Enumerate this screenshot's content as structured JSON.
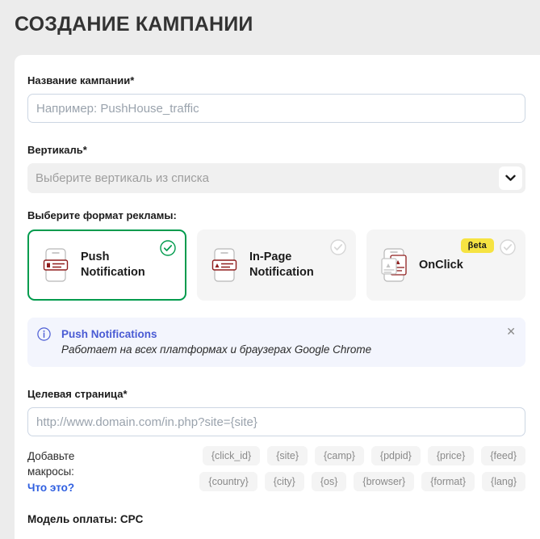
{
  "page": {
    "title": "СОЗДАНИЕ КАМПАНИИ"
  },
  "form": {
    "campaign_name": {
      "label": "Название кампании*",
      "placeholder": "Например: PushHouse_traffic",
      "value": ""
    },
    "vertical": {
      "label": "Вертикаль*",
      "placeholder": "Выберите вертикаль из списка",
      "chevron_icon": "chevron-down-icon"
    },
    "format_section_label": "Выберите формат рекламы:",
    "formats": [
      {
        "label": "Push Notification",
        "icon": "push-notification-phone-icon",
        "selected": true,
        "check_icon": "check-circle-icon",
        "badge": null
      },
      {
        "label": "In-Page Notification",
        "icon": "in-page-notification-phone-icon",
        "selected": false,
        "check_icon": "check-circle-icon",
        "badge": null
      },
      {
        "label": "OnClick",
        "icon": "onclick-phone-icon",
        "selected": false,
        "check_icon": "check-circle-icon",
        "badge": "βeta"
      }
    ],
    "info_banner": {
      "icon": "info-circle-icon",
      "title": "Push Notifications",
      "text": "Работает на всех платформах и браузерах Google Chrome",
      "close_label": "✕"
    },
    "landing_page": {
      "label": "Целевая страница*",
      "placeholder": "http://www.domain.com/in.php?site={site}",
      "value": ""
    },
    "macros": {
      "prompt_line1": "Добавьте",
      "prompt_line2": "макросы:",
      "link": "Что это?",
      "row1": [
        "{click_id}",
        "{site}",
        "{camp}",
        "{pdpid}",
        "{price}",
        "{feed}",
        "{country}",
        "{city}"
      ],
      "row2": [
        "{os}",
        "{browser}",
        "{format}",
        "{lang}"
      ]
    },
    "payment_model": "Модель оплаты: CPC"
  },
  "colors": {
    "page_bg": "#ececec",
    "card_bg": "#ffffff",
    "accent_green": "#009b4d",
    "accent_blue": "#4a5bd4",
    "link_blue": "#2f5fe0",
    "badge_yellow": "#f6e342",
    "icon_red": "#8f1d1d"
  }
}
